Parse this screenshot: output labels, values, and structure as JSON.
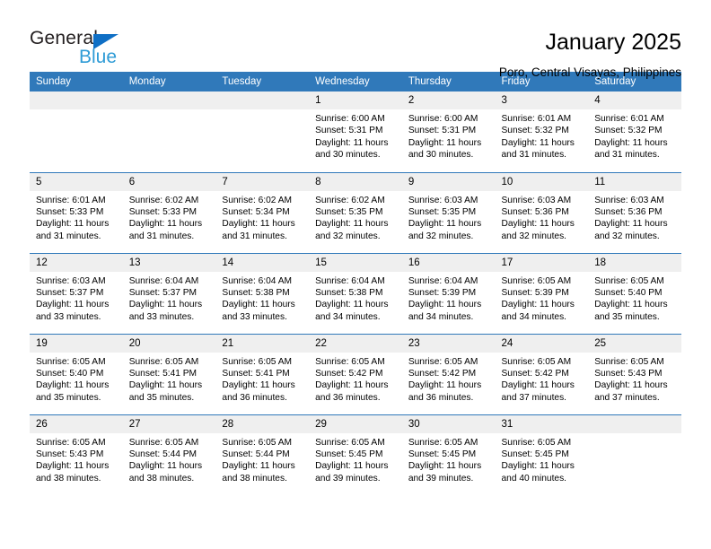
{
  "logo": {
    "text_primary": "General",
    "text_secondary": "Blue",
    "triangle_color": "#0f6fc5",
    "secondary_color": "#2e9bd6"
  },
  "header": {
    "title": "January 2025",
    "subtitle": "Poro, Central Visayas, Philippines"
  },
  "theme": {
    "header_bg": "#3079ba",
    "daynum_bg": "#efefef",
    "grid_line": "#3079ba"
  },
  "calendar": {
    "weekdays": [
      "Sunday",
      "Monday",
      "Tuesday",
      "Wednesday",
      "Thursday",
      "Friday",
      "Saturday"
    ],
    "weeks": [
      [
        {
          "day": "",
          "empty": true
        },
        {
          "day": "",
          "empty": true
        },
        {
          "day": "",
          "empty": true
        },
        {
          "day": "1",
          "sunrise": "Sunrise: 6:00 AM",
          "sunset": "Sunset: 5:31 PM",
          "daylight_line1": "Daylight: 11 hours",
          "daylight_line2": "and 30 minutes."
        },
        {
          "day": "2",
          "sunrise": "Sunrise: 6:00 AM",
          "sunset": "Sunset: 5:31 PM",
          "daylight_line1": "Daylight: 11 hours",
          "daylight_line2": "and 30 minutes."
        },
        {
          "day": "3",
          "sunrise": "Sunrise: 6:01 AM",
          "sunset": "Sunset: 5:32 PM",
          "daylight_line1": "Daylight: 11 hours",
          "daylight_line2": "and 31 minutes."
        },
        {
          "day": "4",
          "sunrise": "Sunrise: 6:01 AM",
          "sunset": "Sunset: 5:32 PM",
          "daylight_line1": "Daylight: 11 hours",
          "daylight_line2": "and 31 minutes."
        }
      ],
      [
        {
          "day": "5",
          "sunrise": "Sunrise: 6:01 AM",
          "sunset": "Sunset: 5:33 PM",
          "daylight_line1": "Daylight: 11 hours",
          "daylight_line2": "and 31 minutes."
        },
        {
          "day": "6",
          "sunrise": "Sunrise: 6:02 AM",
          "sunset": "Sunset: 5:33 PM",
          "daylight_line1": "Daylight: 11 hours",
          "daylight_line2": "and 31 minutes."
        },
        {
          "day": "7",
          "sunrise": "Sunrise: 6:02 AM",
          "sunset": "Sunset: 5:34 PM",
          "daylight_line1": "Daylight: 11 hours",
          "daylight_line2": "and 31 minutes."
        },
        {
          "day": "8",
          "sunrise": "Sunrise: 6:02 AM",
          "sunset": "Sunset: 5:35 PM",
          "daylight_line1": "Daylight: 11 hours",
          "daylight_line2": "and 32 minutes."
        },
        {
          "day": "9",
          "sunrise": "Sunrise: 6:03 AM",
          "sunset": "Sunset: 5:35 PM",
          "daylight_line1": "Daylight: 11 hours",
          "daylight_line2": "and 32 minutes."
        },
        {
          "day": "10",
          "sunrise": "Sunrise: 6:03 AM",
          "sunset": "Sunset: 5:36 PM",
          "daylight_line1": "Daylight: 11 hours",
          "daylight_line2": "and 32 minutes."
        },
        {
          "day": "11",
          "sunrise": "Sunrise: 6:03 AM",
          "sunset": "Sunset: 5:36 PM",
          "daylight_line1": "Daylight: 11 hours",
          "daylight_line2": "and 32 minutes."
        }
      ],
      [
        {
          "day": "12",
          "sunrise": "Sunrise: 6:03 AM",
          "sunset": "Sunset: 5:37 PM",
          "daylight_line1": "Daylight: 11 hours",
          "daylight_line2": "and 33 minutes."
        },
        {
          "day": "13",
          "sunrise": "Sunrise: 6:04 AM",
          "sunset": "Sunset: 5:37 PM",
          "daylight_line1": "Daylight: 11 hours",
          "daylight_line2": "and 33 minutes."
        },
        {
          "day": "14",
          "sunrise": "Sunrise: 6:04 AM",
          "sunset": "Sunset: 5:38 PM",
          "daylight_line1": "Daylight: 11 hours",
          "daylight_line2": "and 33 minutes."
        },
        {
          "day": "15",
          "sunrise": "Sunrise: 6:04 AM",
          "sunset": "Sunset: 5:38 PM",
          "daylight_line1": "Daylight: 11 hours",
          "daylight_line2": "and 34 minutes."
        },
        {
          "day": "16",
          "sunrise": "Sunrise: 6:04 AM",
          "sunset": "Sunset: 5:39 PM",
          "daylight_line1": "Daylight: 11 hours",
          "daylight_line2": "and 34 minutes."
        },
        {
          "day": "17",
          "sunrise": "Sunrise: 6:05 AM",
          "sunset": "Sunset: 5:39 PM",
          "daylight_line1": "Daylight: 11 hours",
          "daylight_line2": "and 34 minutes."
        },
        {
          "day": "18",
          "sunrise": "Sunrise: 6:05 AM",
          "sunset": "Sunset: 5:40 PM",
          "daylight_line1": "Daylight: 11 hours",
          "daylight_line2": "and 35 minutes."
        }
      ],
      [
        {
          "day": "19",
          "sunrise": "Sunrise: 6:05 AM",
          "sunset": "Sunset: 5:40 PM",
          "daylight_line1": "Daylight: 11 hours",
          "daylight_line2": "and 35 minutes."
        },
        {
          "day": "20",
          "sunrise": "Sunrise: 6:05 AM",
          "sunset": "Sunset: 5:41 PM",
          "daylight_line1": "Daylight: 11 hours",
          "daylight_line2": "and 35 minutes."
        },
        {
          "day": "21",
          "sunrise": "Sunrise: 6:05 AM",
          "sunset": "Sunset: 5:41 PM",
          "daylight_line1": "Daylight: 11 hours",
          "daylight_line2": "and 36 minutes."
        },
        {
          "day": "22",
          "sunrise": "Sunrise: 6:05 AM",
          "sunset": "Sunset: 5:42 PM",
          "daylight_line1": "Daylight: 11 hours",
          "daylight_line2": "and 36 minutes."
        },
        {
          "day": "23",
          "sunrise": "Sunrise: 6:05 AM",
          "sunset": "Sunset: 5:42 PM",
          "daylight_line1": "Daylight: 11 hours",
          "daylight_line2": "and 36 minutes."
        },
        {
          "day": "24",
          "sunrise": "Sunrise: 6:05 AM",
          "sunset": "Sunset: 5:42 PM",
          "daylight_line1": "Daylight: 11 hours",
          "daylight_line2": "and 37 minutes."
        },
        {
          "day": "25",
          "sunrise": "Sunrise: 6:05 AM",
          "sunset": "Sunset: 5:43 PM",
          "daylight_line1": "Daylight: 11 hours",
          "daylight_line2": "and 37 minutes."
        }
      ],
      [
        {
          "day": "26",
          "sunrise": "Sunrise: 6:05 AM",
          "sunset": "Sunset: 5:43 PM",
          "daylight_line1": "Daylight: 11 hours",
          "daylight_line2": "and 38 minutes."
        },
        {
          "day": "27",
          "sunrise": "Sunrise: 6:05 AM",
          "sunset": "Sunset: 5:44 PM",
          "daylight_line1": "Daylight: 11 hours",
          "daylight_line2": "and 38 minutes."
        },
        {
          "day": "28",
          "sunrise": "Sunrise: 6:05 AM",
          "sunset": "Sunset: 5:44 PM",
          "daylight_line1": "Daylight: 11 hours",
          "daylight_line2": "and 38 minutes."
        },
        {
          "day": "29",
          "sunrise": "Sunrise: 6:05 AM",
          "sunset": "Sunset: 5:45 PM",
          "daylight_line1": "Daylight: 11 hours",
          "daylight_line2": "and 39 minutes."
        },
        {
          "day": "30",
          "sunrise": "Sunrise: 6:05 AM",
          "sunset": "Sunset: 5:45 PM",
          "daylight_line1": "Daylight: 11 hours",
          "daylight_line2": "and 39 minutes."
        },
        {
          "day": "31",
          "sunrise": "Sunrise: 6:05 AM",
          "sunset": "Sunset: 5:45 PM",
          "daylight_line1": "Daylight: 11 hours",
          "daylight_line2": "and 40 minutes."
        },
        {
          "day": "",
          "empty": true
        }
      ]
    ]
  }
}
